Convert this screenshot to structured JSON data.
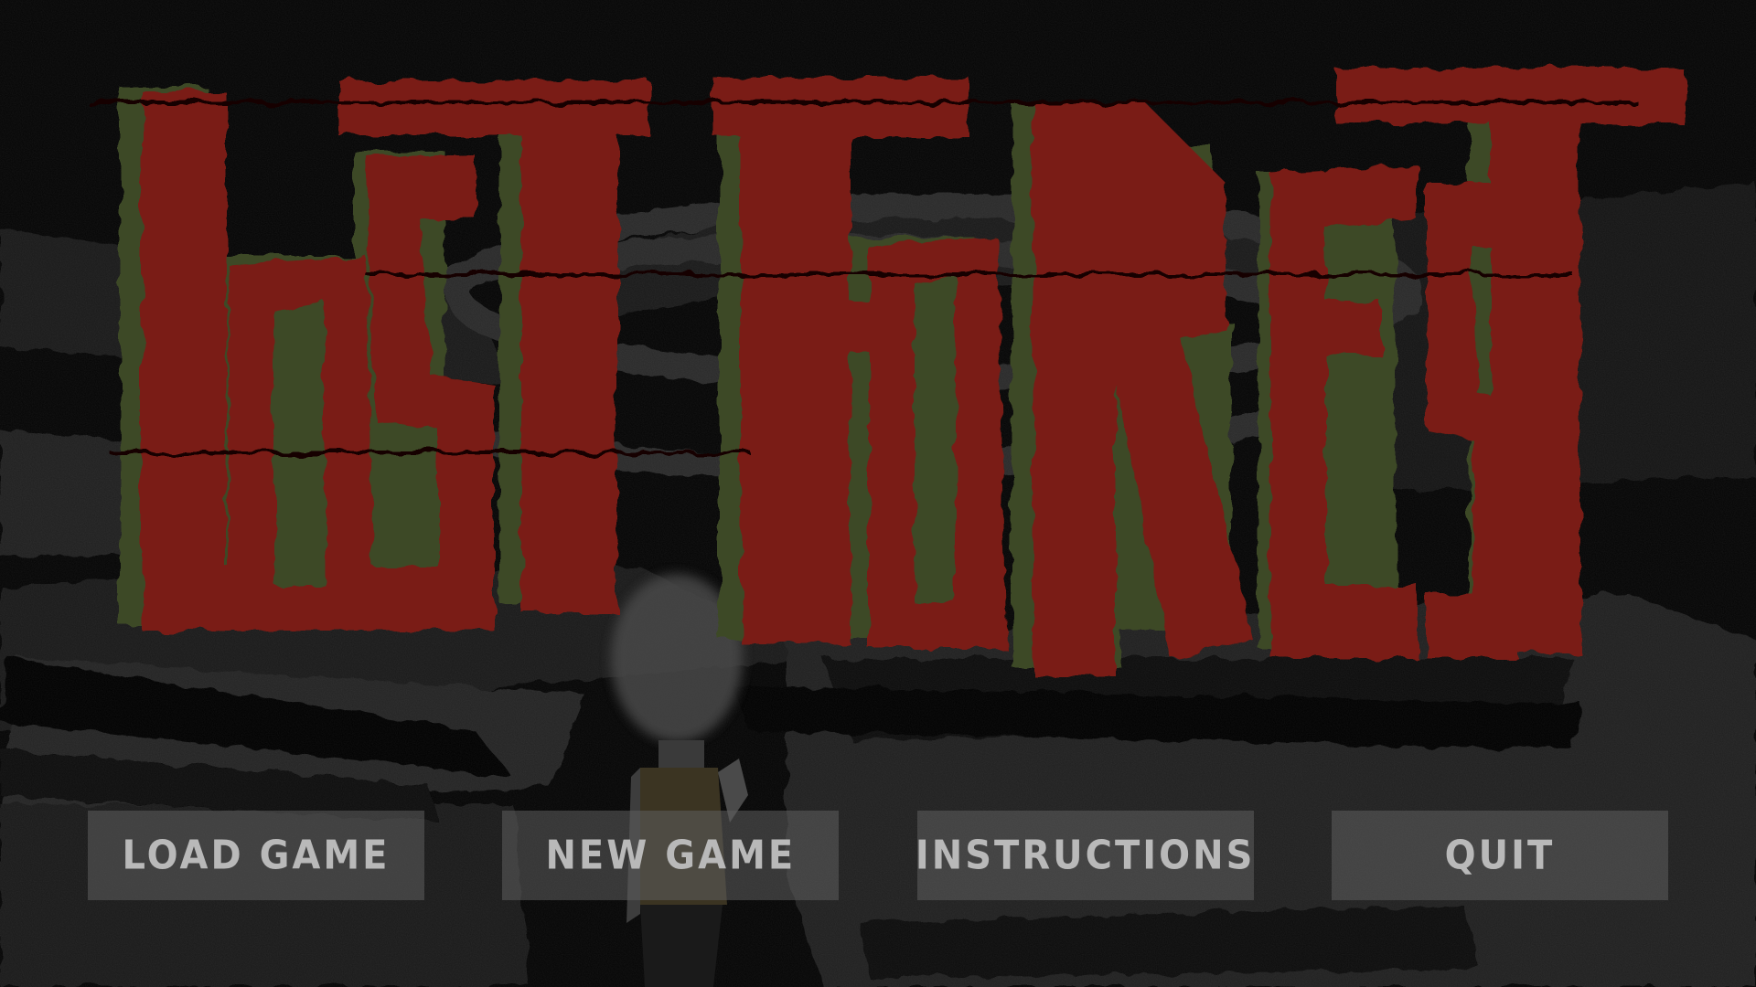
{
  "game": {
    "title": "LOST FOREST"
  },
  "menu": {
    "items": [
      {
        "label": "LOAD GAME"
      },
      {
        "label": "NEW GAME"
      },
      {
        "label": "INSTRUCTIONS"
      },
      {
        "label": "QUIT"
      }
    ]
  },
  "colors": {
    "background": "#050505",
    "title_red": "#7a1a12",
    "title_shadow": "#3e4a25",
    "button_bg": "#5f5f5f",
    "button_text": "#b9b9b9"
  }
}
